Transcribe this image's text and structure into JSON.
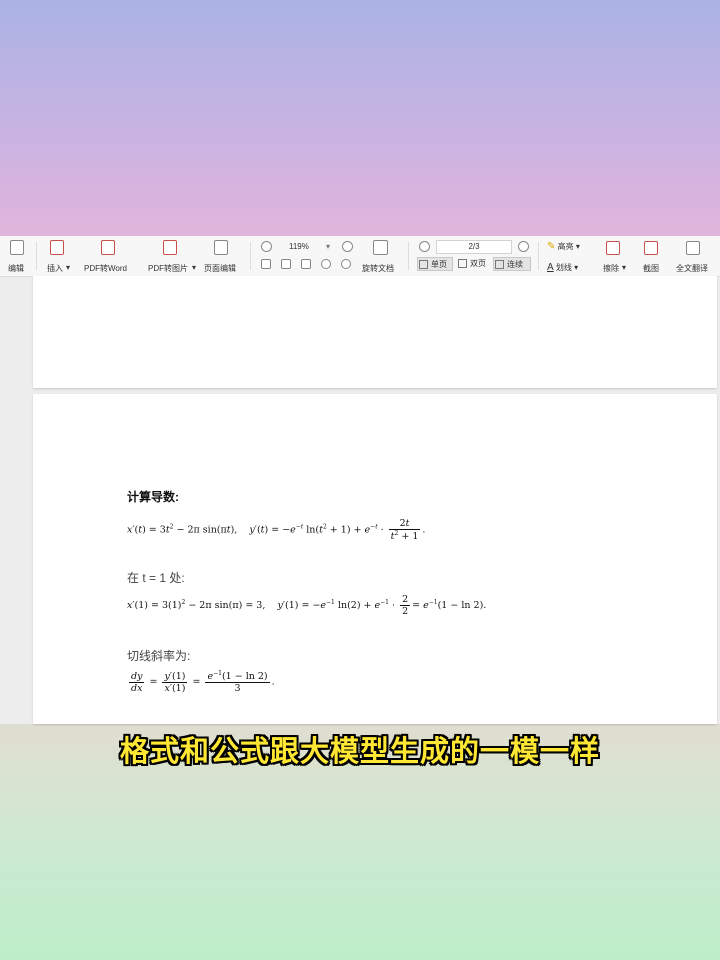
{
  "toolbar": {
    "edit": "编辑",
    "insert": "插入",
    "pdf_to_word": "PDF转Word",
    "pdf_to_image": "PDF转图片",
    "page_edit": "页面编辑",
    "zoom": "119%",
    "rotate_doc": "旋转文档",
    "page_indicator": "2/3",
    "single_page": "单页",
    "double_page": "双页",
    "continuous": "连续",
    "highlight": "高亮",
    "underline": "划线",
    "erase": "擦除",
    "screenshot": "截图",
    "translate": "全文翻译"
  },
  "document": {
    "heading": "计算导数:",
    "at_point": "在 t = 1 处:",
    "slope_label": "切线斜率为:"
  },
  "caption": "格式和公式跟大模型生成的一模一样",
  "colors": {
    "caption_fill": "#ffe733",
    "caption_stroke": "#000000"
  }
}
